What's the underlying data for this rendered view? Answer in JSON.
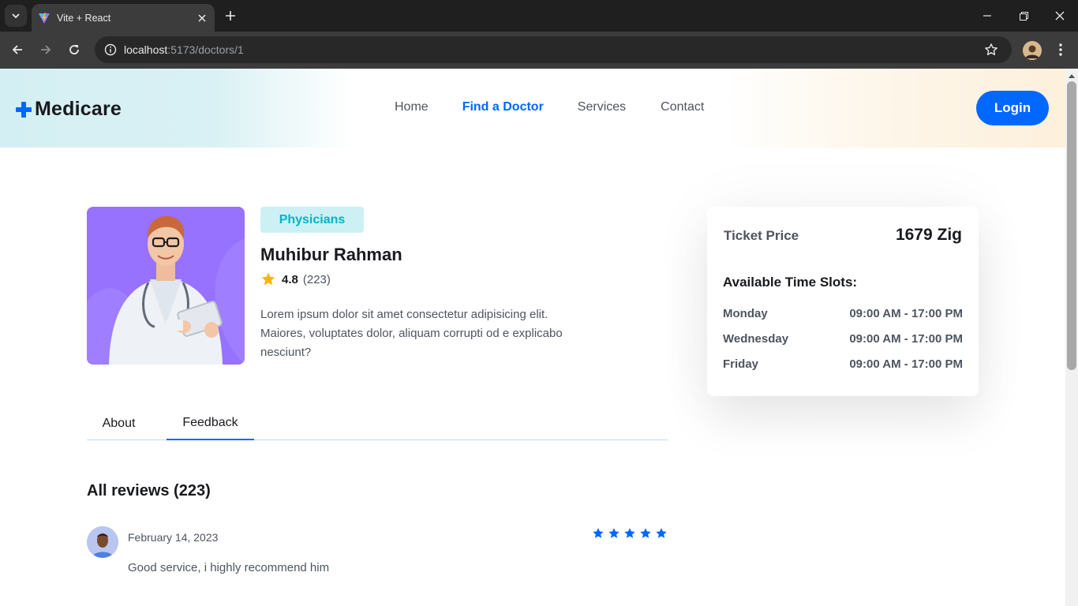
{
  "browser": {
    "tab_title": "Vite + React",
    "url_host": "localhost",
    "url_rest": ":5173/doctors/1"
  },
  "header": {
    "logo_text": "Medicare",
    "nav": [
      "Home",
      "Find a Doctor",
      "Services",
      "Contact"
    ],
    "active_nav": "Find a Doctor",
    "login_label": "Login"
  },
  "doctor": {
    "specialization": "Physicians",
    "name": "Muhibur Rahman",
    "rating": "4.8",
    "rating_count": "(223)",
    "bio": "Lorem ipsum dolor sit amet consectetur adipisicing elit. Maiores, voluptates dolor, aliquam corrupti od e explicabo nesciunt?"
  },
  "tabs": [
    "About",
    "Feedback"
  ],
  "active_tab": "Feedback",
  "reviews": {
    "title": "All reviews (223)",
    "items": [
      {
        "date": "February 14, 2023",
        "text": "Good service, i highly recommend him",
        "stars": 5
      }
    ]
  },
  "side_panel": {
    "price_label": "Ticket Price",
    "price_value": "1679 Zig",
    "slots_title": "Available Time Slots:",
    "slots": [
      {
        "day": "Monday",
        "time": "09:00 AM - 17:00 PM"
      },
      {
        "day": "Wednesday",
        "time": "09:00 AM - 17:00 PM"
      },
      {
        "day": "Friday",
        "time": "09:00 AM - 17:00 PM"
      }
    ]
  },
  "colors": {
    "primary": "#0067ff",
    "heading": "#181a1e",
    "text": "#4e545f",
    "badge_bg": "#ccf0f3",
    "badge_text": "#01b5c5",
    "rating_star": "#feb60d",
    "photo_bg": "#9771ff"
  },
  "icons": {
    "tab_search": "chevron-down-icon",
    "favicon": "vite-logo-icon",
    "tab_close": "close-icon",
    "new_tab": "plus-icon",
    "back": "arrow-left-icon",
    "forward": "arrow-right-icon",
    "reload": "reload-icon",
    "site_info": "info-icon",
    "bookmark": "star-outline-icon",
    "menu": "kebab-menu-icon"
  }
}
